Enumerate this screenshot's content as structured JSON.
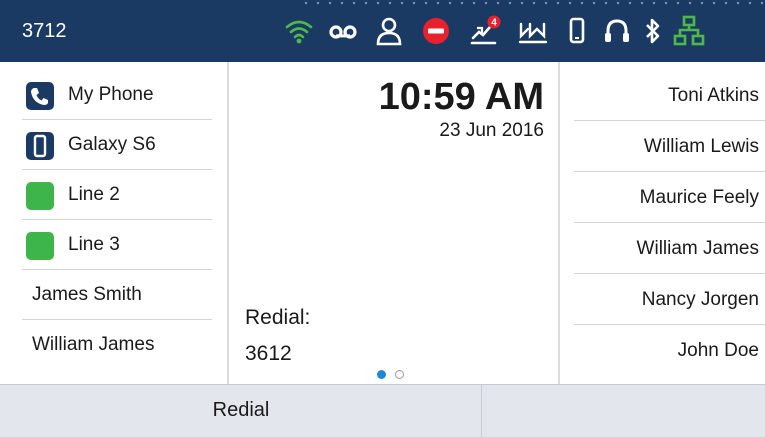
{
  "status_bar": {
    "extension": "3712",
    "icons": [
      {
        "name": "wifi-icon",
        "color": "#4fb84b"
      },
      {
        "name": "voicemail-icon",
        "color": "#ffffff"
      },
      {
        "name": "presence-icon",
        "color": "#ffffff"
      },
      {
        "name": "do-not-disturb-icon",
        "color": "#e8212d"
      },
      {
        "name": "missed-calls-icon",
        "color": "#ffffff",
        "badge": "4",
        "badge_color": "#e8212d"
      },
      {
        "name": "call-forward-icon",
        "color": "#ffffff"
      },
      {
        "name": "mobile-phone-icon",
        "color": "#ffffff"
      },
      {
        "name": "headset-icon",
        "color": "#ffffff"
      },
      {
        "name": "bluetooth-icon",
        "color": "#ffffff"
      },
      {
        "name": "network-icon",
        "color": "#4fb84b"
      }
    ]
  },
  "line_keys": [
    {
      "label": "My Phone",
      "icon": "phone-icon",
      "icon_color": "#1b3a63"
    },
    {
      "label": "Galaxy S6",
      "icon": "mobile-phone-icon",
      "icon_color": "#1b3a63"
    },
    {
      "label": "Line 2",
      "icon": "line-status-indicator",
      "icon_color": "#3db54a"
    },
    {
      "label": "Line 3",
      "icon": "line-status-indicator",
      "icon_color": "#3db54a"
    },
    {
      "label": "James Smith"
    },
    {
      "label": "William James"
    }
  ],
  "center": {
    "time": "10:59 AM",
    "date": "23 Jun 2016",
    "redial_label": "Redial:",
    "redial_number": "3612",
    "page_count": 2,
    "page_current": 1
  },
  "speed_dials": [
    {
      "label": "Toni Atkins"
    },
    {
      "label": "William Lewis"
    },
    {
      "label": "Maurice Feely"
    },
    {
      "label": "William James"
    },
    {
      "label": "Nancy Jorgen"
    },
    {
      "label": "John Doe"
    }
  ],
  "softkeys": [
    {
      "label": "Redial"
    }
  ],
  "colors": {
    "header_background": "#1b3a63",
    "accent_green": "#3db54a",
    "page_indicator_active": "#1e88d6",
    "softkey_bar_background": "#e3e6ec"
  }
}
